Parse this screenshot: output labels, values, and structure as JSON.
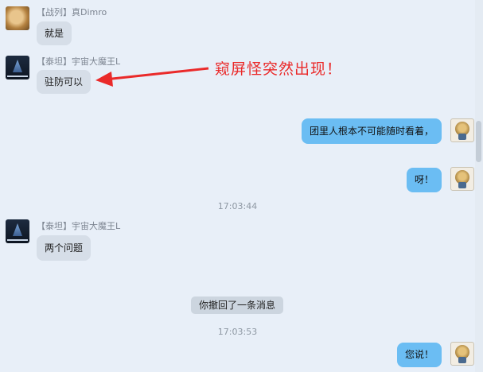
{
  "messages": [
    {
      "group": "【战列】",
      "sender": "真Dimro",
      "text": "就是"
    },
    {
      "group": "【泰坦】",
      "sender": "宇宙大魔王L",
      "text": "驻防可以"
    },
    {
      "text": "团里人根本不可能随时看着，"
    },
    {
      "text": "呀！"
    },
    {
      "time": "17:03:44"
    },
    {
      "group": "【泰坦】",
      "sender": "宇宙大魔王L",
      "text": "两个问题"
    },
    {
      "system": "你撤回了一条消息"
    },
    {
      "time": "17:03:53"
    },
    {
      "text": "您说！"
    }
  ],
  "annotation": {
    "text": "窥屏怪突然出现！",
    "color": "#ea2a2a"
  },
  "colors": {
    "outgoing_bubble": "#6bbdf3",
    "incoming_bubble": "#d6dee8",
    "background": "#e8eff8"
  }
}
